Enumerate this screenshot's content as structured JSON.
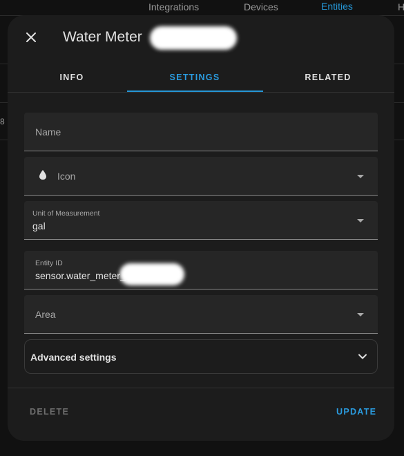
{
  "background_page": {
    "tabs": [
      "Integrations",
      "Devices",
      "Entities",
      "H"
    ],
    "active_tab": "Entities",
    "row_fragment": "8"
  },
  "dialog": {
    "title": "Water Meter",
    "close_icon": "close-icon",
    "tabs": [
      {
        "label": "INFO"
      },
      {
        "label": "SETTINGS"
      },
      {
        "label": "RELATED"
      }
    ],
    "active_tab": "SETTINGS",
    "fields": {
      "name": {
        "label": "Name",
        "value": ""
      },
      "icon": {
        "label": "Icon",
        "icon": "water-drop-icon"
      },
      "unit": {
        "label": "Unit of Measurement",
        "value": "gal"
      },
      "entity_id": {
        "label": "Entity ID",
        "value": "sensor.water_meter_"
      },
      "area": {
        "label": "Area",
        "value": ""
      }
    },
    "advanced_label": "Advanced settings",
    "delete_label": "DELETE",
    "update_label": "UPDATE"
  },
  "colors": {
    "accent": "#2596d6",
    "surface": "#1c1c1c",
    "field_bg": "#262626"
  }
}
